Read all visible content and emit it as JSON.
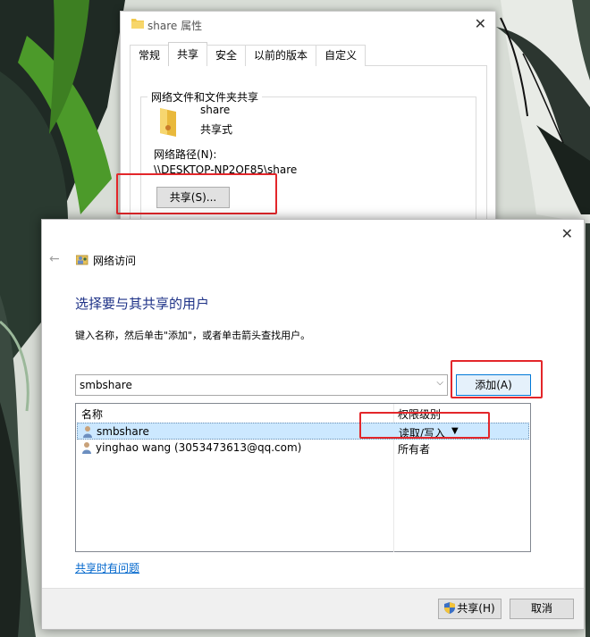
{
  "properties_dialog": {
    "title": "share 属性",
    "tabs": [
      {
        "label": "常规"
      },
      {
        "label": "共享"
      },
      {
        "label": "安全"
      },
      {
        "label": "以前的版本"
      },
      {
        "label": "自定义"
      }
    ],
    "group_title": "网络文件和文件夹共享",
    "folder_name": "share",
    "share_state": "共享式",
    "path_label": "网络路径(N):",
    "path_value": "\\\\DESKTOP-NP2OF85\\share",
    "share_button": "共享(S)..."
  },
  "access_dialog": {
    "title": "网络访问",
    "heading": "选择要与其共享的用户",
    "hint": "键入名称，然后单击\"添加\"，或者单击箭头查找用户。",
    "combo_value": "smbshare",
    "add_button": "添加(A)",
    "columns": {
      "name": "名称",
      "permission": "权限级别"
    },
    "rows": [
      {
        "name": "smbshare",
        "permission": "读取/写入"
      },
      {
        "name": "yinghao wang (3053473613@qq.com)",
        "permission": "所有者"
      }
    ],
    "help_link": "共享时有问题",
    "share_h_button": "共享(H)",
    "cancel_button": "取消"
  },
  "icons": {
    "folder": "folder-icon",
    "user": "user-icon",
    "shield": "uac-shield-icon",
    "network": "network-access-icon"
  },
  "colors": {
    "annotation_red": "#e3262a",
    "heading_blue": "#1e3287",
    "selection_blue": "#cce8ff",
    "link_blue": "#0066cc"
  }
}
